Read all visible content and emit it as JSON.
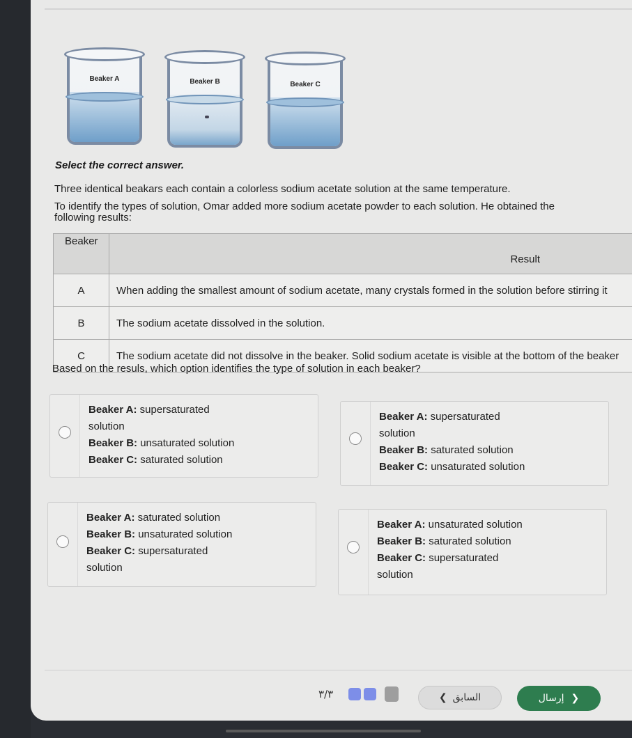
{
  "beakers": [
    {
      "label": "Beaker A"
    },
    {
      "label": "Beaker B"
    },
    {
      "label": "Beaker C"
    }
  ],
  "question": {
    "heading": "Select the correct answer.",
    "line1": "Three identical beakars each contain a colorless sodium acetate solution at the same temperature.",
    "line2": "To identify the types of solution, Omar added more sodium acetate powder to each solution. He obtained the",
    "line3": "following results:",
    "followup": "Based on the resuls, which option identifies the type of solution in each beaker?"
  },
  "table": {
    "headers": [
      "Beaker",
      "Result"
    ],
    "rows": [
      {
        "beaker": "A",
        "result": "When adding the smallest amount of sodium acetate, many crystals formed in the solution before stirring it"
      },
      {
        "beaker": "B",
        "result": "The sodium acetate dissolved in the solution."
      },
      {
        "beaker": "C",
        "result": "The sodium acetate did not dissolve in the beaker. Solid sodium acetate is visible at the bottom of the beaker"
      }
    ]
  },
  "options": [
    {
      "a_key": "Beaker A:",
      "a_val": "supersaturated",
      "a_val2": "solution",
      "b_key": "Beaker B:",
      "b_val": "unsaturated solution",
      "c_key": "Beaker C:",
      "c_val": "saturated solution"
    },
    {
      "a_key": "Beaker A:",
      "a_val": "supersaturated",
      "a_val2": "solution",
      "b_key": "Beaker B:",
      "b_val": "saturated solution",
      "c_key": "Beaker C:",
      "c_val": "unsaturated solution"
    },
    {
      "a_key": "Beaker A:",
      "a_val": "saturated solution",
      "b_key": "Beaker B:",
      "b_val": "unsaturated solution",
      "c_key": "Beaker C:",
      "c_val": "supersaturated",
      "c_val2": "solution"
    },
    {
      "a_key": "Beaker A:",
      "a_val": "unsaturated solution",
      "b_key": "Beaker B:",
      "b_val": "saturated solution",
      "c_key": "Beaker C:",
      "c_val": "supersaturated",
      "c_val2": "solution"
    }
  ],
  "footer": {
    "page": "٣/٣",
    "prev_label": "السابق",
    "next_label": "إرسال",
    "accent": "#2e7d4f",
    "progress_colors": [
      "#7d8ee8",
      "#7d8ee8",
      "#9e9e9e"
    ]
  }
}
